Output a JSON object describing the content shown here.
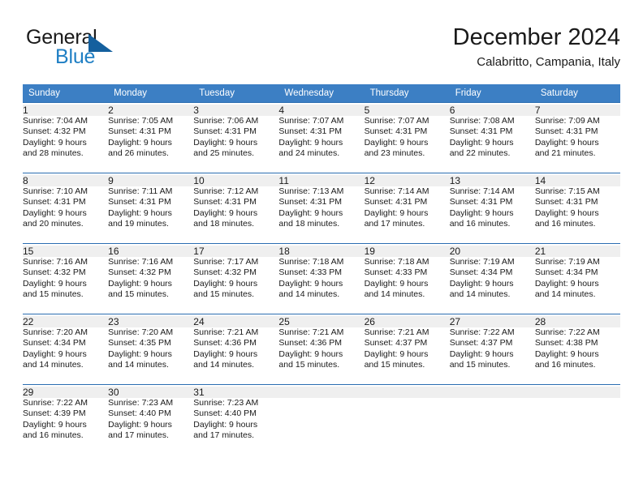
{
  "brand": {
    "name_part1": "General",
    "name_part2": "Blue",
    "accent_color": "#1f7fc4",
    "triangle_color": "#14609e",
    "logo_icon": "triangle-flag-icon"
  },
  "header": {
    "title": "December 2024",
    "subtitle": "Calabritto, Campania, Italy"
  },
  "calendar": {
    "header_bg": "#3c7fc4",
    "daynum_bg": "#efefef",
    "separator_color": "#2a6db1",
    "weekdays": [
      "Sunday",
      "Monday",
      "Tuesday",
      "Wednesday",
      "Thursday",
      "Friday",
      "Saturday"
    ],
    "weeks": [
      [
        {
          "day": "1",
          "sunrise": "Sunrise: 7:04 AM",
          "sunset": "Sunset: 4:32 PM",
          "daylight1": "Daylight: 9 hours",
          "daylight2": "and 28 minutes."
        },
        {
          "day": "2",
          "sunrise": "Sunrise: 7:05 AM",
          "sunset": "Sunset: 4:31 PM",
          "daylight1": "Daylight: 9 hours",
          "daylight2": "and 26 minutes."
        },
        {
          "day": "3",
          "sunrise": "Sunrise: 7:06 AM",
          "sunset": "Sunset: 4:31 PM",
          "daylight1": "Daylight: 9 hours",
          "daylight2": "and 25 minutes."
        },
        {
          "day": "4",
          "sunrise": "Sunrise: 7:07 AM",
          "sunset": "Sunset: 4:31 PM",
          "daylight1": "Daylight: 9 hours",
          "daylight2": "and 24 minutes."
        },
        {
          "day": "5",
          "sunrise": "Sunrise: 7:07 AM",
          "sunset": "Sunset: 4:31 PM",
          "daylight1": "Daylight: 9 hours",
          "daylight2": "and 23 minutes."
        },
        {
          "day": "6",
          "sunrise": "Sunrise: 7:08 AM",
          "sunset": "Sunset: 4:31 PM",
          "daylight1": "Daylight: 9 hours",
          "daylight2": "and 22 minutes."
        },
        {
          "day": "7",
          "sunrise": "Sunrise: 7:09 AM",
          "sunset": "Sunset: 4:31 PM",
          "daylight1": "Daylight: 9 hours",
          "daylight2": "and 21 minutes."
        }
      ],
      [
        {
          "day": "8",
          "sunrise": "Sunrise: 7:10 AM",
          "sunset": "Sunset: 4:31 PM",
          "daylight1": "Daylight: 9 hours",
          "daylight2": "and 20 minutes."
        },
        {
          "day": "9",
          "sunrise": "Sunrise: 7:11 AM",
          "sunset": "Sunset: 4:31 PM",
          "daylight1": "Daylight: 9 hours",
          "daylight2": "and 19 minutes."
        },
        {
          "day": "10",
          "sunrise": "Sunrise: 7:12 AM",
          "sunset": "Sunset: 4:31 PM",
          "daylight1": "Daylight: 9 hours",
          "daylight2": "and 18 minutes."
        },
        {
          "day": "11",
          "sunrise": "Sunrise: 7:13 AM",
          "sunset": "Sunset: 4:31 PM",
          "daylight1": "Daylight: 9 hours",
          "daylight2": "and 18 minutes."
        },
        {
          "day": "12",
          "sunrise": "Sunrise: 7:14 AM",
          "sunset": "Sunset: 4:31 PM",
          "daylight1": "Daylight: 9 hours",
          "daylight2": "and 17 minutes."
        },
        {
          "day": "13",
          "sunrise": "Sunrise: 7:14 AM",
          "sunset": "Sunset: 4:31 PM",
          "daylight1": "Daylight: 9 hours",
          "daylight2": "and 16 minutes."
        },
        {
          "day": "14",
          "sunrise": "Sunrise: 7:15 AM",
          "sunset": "Sunset: 4:31 PM",
          "daylight1": "Daylight: 9 hours",
          "daylight2": "and 16 minutes."
        }
      ],
      [
        {
          "day": "15",
          "sunrise": "Sunrise: 7:16 AM",
          "sunset": "Sunset: 4:32 PM",
          "daylight1": "Daylight: 9 hours",
          "daylight2": "and 15 minutes."
        },
        {
          "day": "16",
          "sunrise": "Sunrise: 7:16 AM",
          "sunset": "Sunset: 4:32 PM",
          "daylight1": "Daylight: 9 hours",
          "daylight2": "and 15 minutes."
        },
        {
          "day": "17",
          "sunrise": "Sunrise: 7:17 AM",
          "sunset": "Sunset: 4:32 PM",
          "daylight1": "Daylight: 9 hours",
          "daylight2": "and 15 minutes."
        },
        {
          "day": "18",
          "sunrise": "Sunrise: 7:18 AM",
          "sunset": "Sunset: 4:33 PM",
          "daylight1": "Daylight: 9 hours",
          "daylight2": "and 14 minutes."
        },
        {
          "day": "19",
          "sunrise": "Sunrise: 7:18 AM",
          "sunset": "Sunset: 4:33 PM",
          "daylight1": "Daylight: 9 hours",
          "daylight2": "and 14 minutes."
        },
        {
          "day": "20",
          "sunrise": "Sunrise: 7:19 AM",
          "sunset": "Sunset: 4:34 PM",
          "daylight1": "Daylight: 9 hours",
          "daylight2": "and 14 minutes."
        },
        {
          "day": "21",
          "sunrise": "Sunrise: 7:19 AM",
          "sunset": "Sunset: 4:34 PM",
          "daylight1": "Daylight: 9 hours",
          "daylight2": "and 14 minutes."
        }
      ],
      [
        {
          "day": "22",
          "sunrise": "Sunrise: 7:20 AM",
          "sunset": "Sunset: 4:34 PM",
          "daylight1": "Daylight: 9 hours",
          "daylight2": "and 14 minutes."
        },
        {
          "day": "23",
          "sunrise": "Sunrise: 7:20 AM",
          "sunset": "Sunset: 4:35 PM",
          "daylight1": "Daylight: 9 hours",
          "daylight2": "and 14 minutes."
        },
        {
          "day": "24",
          "sunrise": "Sunrise: 7:21 AM",
          "sunset": "Sunset: 4:36 PM",
          "daylight1": "Daylight: 9 hours",
          "daylight2": "and 14 minutes."
        },
        {
          "day": "25",
          "sunrise": "Sunrise: 7:21 AM",
          "sunset": "Sunset: 4:36 PM",
          "daylight1": "Daylight: 9 hours",
          "daylight2": "and 15 minutes."
        },
        {
          "day": "26",
          "sunrise": "Sunrise: 7:21 AM",
          "sunset": "Sunset: 4:37 PM",
          "daylight1": "Daylight: 9 hours",
          "daylight2": "and 15 minutes."
        },
        {
          "day": "27",
          "sunrise": "Sunrise: 7:22 AM",
          "sunset": "Sunset: 4:37 PM",
          "daylight1": "Daylight: 9 hours",
          "daylight2": "and 15 minutes."
        },
        {
          "day": "28",
          "sunrise": "Sunrise: 7:22 AM",
          "sunset": "Sunset: 4:38 PM",
          "daylight1": "Daylight: 9 hours",
          "daylight2": "and 16 minutes."
        }
      ],
      [
        {
          "day": "29",
          "sunrise": "Sunrise: 7:22 AM",
          "sunset": "Sunset: 4:39 PM",
          "daylight1": "Daylight: 9 hours",
          "daylight2": "and 16 minutes."
        },
        {
          "day": "30",
          "sunrise": "Sunrise: 7:23 AM",
          "sunset": "Sunset: 4:40 PM",
          "daylight1": "Daylight: 9 hours",
          "daylight2": "and 17 minutes."
        },
        {
          "day": "31",
          "sunrise": "Sunrise: 7:23 AM",
          "sunset": "Sunset: 4:40 PM",
          "daylight1": "Daylight: 9 hours",
          "daylight2": "and 17 minutes."
        },
        {
          "day": "",
          "sunrise": "",
          "sunset": "",
          "daylight1": "",
          "daylight2": ""
        },
        {
          "day": "",
          "sunrise": "",
          "sunset": "",
          "daylight1": "",
          "daylight2": ""
        },
        {
          "day": "",
          "sunrise": "",
          "sunset": "",
          "daylight1": "",
          "daylight2": ""
        },
        {
          "day": "",
          "sunrise": "",
          "sunset": "",
          "daylight1": "",
          "daylight2": ""
        }
      ]
    ]
  }
}
